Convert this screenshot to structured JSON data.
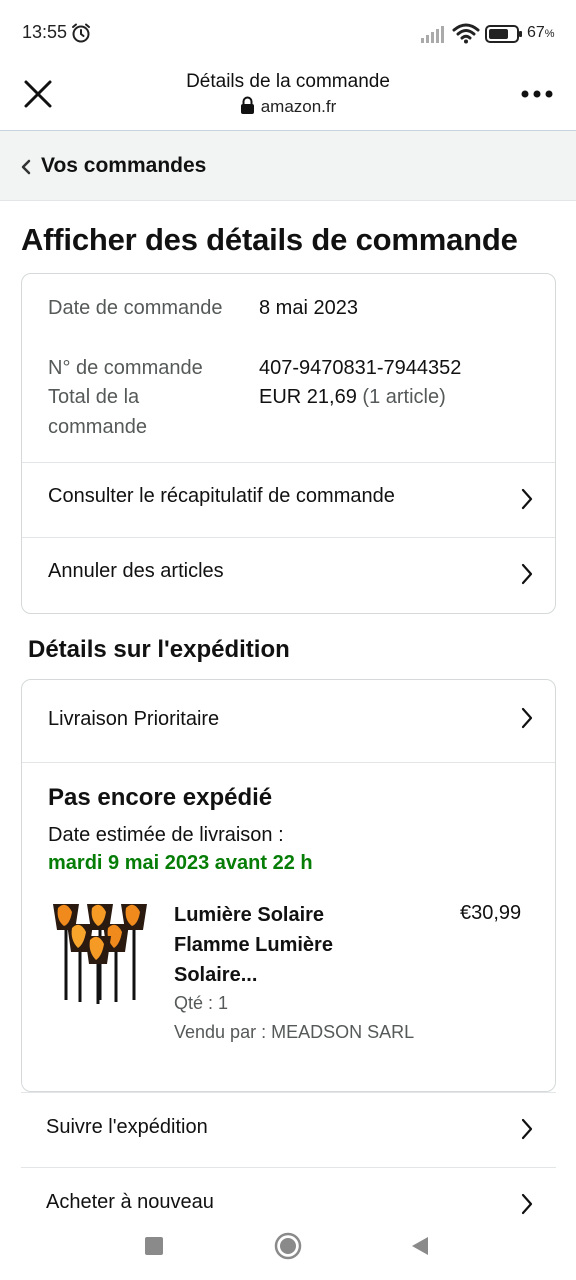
{
  "status_bar": {
    "time": "13:55",
    "battery": "67",
    "battery_unit": "%",
    "icons": [
      "alarm-icon",
      "signal-icon",
      "wifi-icon",
      "battery-icon"
    ]
  },
  "browser": {
    "title": "Détails de la commande",
    "domain": "amazon.fr",
    "icons": [
      "close-icon",
      "lock-icon",
      "more-icon"
    ]
  },
  "breadcrumb": {
    "label": "Vos commandes"
  },
  "page": {
    "title": "Afficher des détails de commande"
  },
  "order_info": {
    "date_label": "Date de commande",
    "date_value": "8 mai 2023",
    "number_label": "N° de commande",
    "number_value": "407-9470831-7944352",
    "total_label": "Total de la commande",
    "total_value": "EUR 21,69",
    "total_items": "(1 article)"
  },
  "order_links": {
    "summary": "Consulter le récapitulatif de commande",
    "cancel": "Annuler des articles"
  },
  "shipping": {
    "section_title": "Détails sur l'expédition",
    "method": "Livraison Prioritaire",
    "status": "Pas encore expédié",
    "est_label": "Date estimée de livraison :",
    "est_value": "mardi 9 mai 2023 avant 22 h",
    "status_color": "#067d06"
  },
  "product": {
    "title_line1": "Lumière Solaire",
    "title_line2": "Flamme Lumière",
    "title_line3": "Solaire...",
    "price": "€30,99",
    "qty": "Qté : 1",
    "seller": "Vendu par : MEADSON SARL"
  },
  "actions": {
    "track": "Suivre l'expédition",
    "buy_again": "Acheter à nouveau"
  },
  "nav_bar": {
    "icons": [
      "recents-icon",
      "home-icon",
      "back-icon"
    ]
  }
}
